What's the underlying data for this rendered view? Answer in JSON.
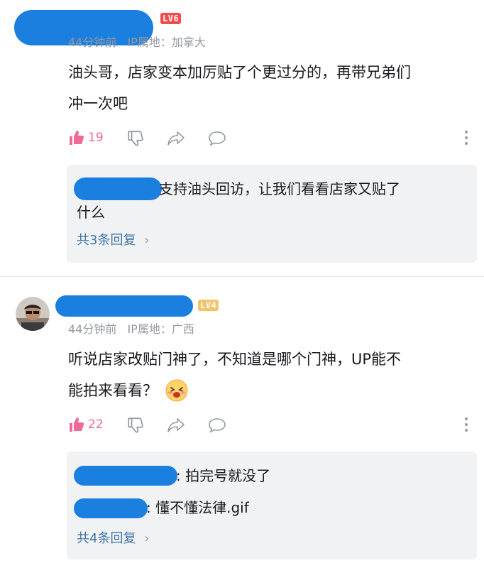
{
  "comments": [
    {
      "level_badge": "LV6",
      "level_color": "#f24c4c",
      "time": "44分钟前",
      "ip": "IP属地：加拿大",
      "text_lines": [
        "油头哥，店家变本加厉贴了个更过分的，再带兄弟们",
        "冲一次吧"
      ],
      "likes": "19",
      "liked": true,
      "replies": [
        {
          "text": " 支持油头回访，让我们看看店家又贴了",
          "text_cont": "什么"
        }
      ],
      "more_replies": "共3条回复"
    },
    {
      "level_badge": "LV4",
      "level_color": "#f0c46a",
      "time": "44分钟前",
      "ip": "IP属地：广西",
      "text_lines": [
        "听说店家改贴门神了，不知道是哪个门神，UP能不",
        "能拍来看看？"
      ],
      "likes": "22",
      "liked": true,
      "replies": [
        {
          "text": ": 拍完号就没了"
        },
        {
          "text": ": 懂不懂法律.gif"
        }
      ],
      "more_replies": "共4条回复"
    }
  ],
  "icons": [
    "thumb-up-icon",
    "thumb-down-icon",
    "share-icon",
    "comment-icon",
    "more-icon",
    "chevron-right-icon",
    "emoji-icon"
  ],
  "colors": {
    "accent_pink": "#ef6a98",
    "link_blue": "#3c74a8",
    "redaction_blue": "#1b7fe0",
    "meta_gray": "#9499a0"
  }
}
